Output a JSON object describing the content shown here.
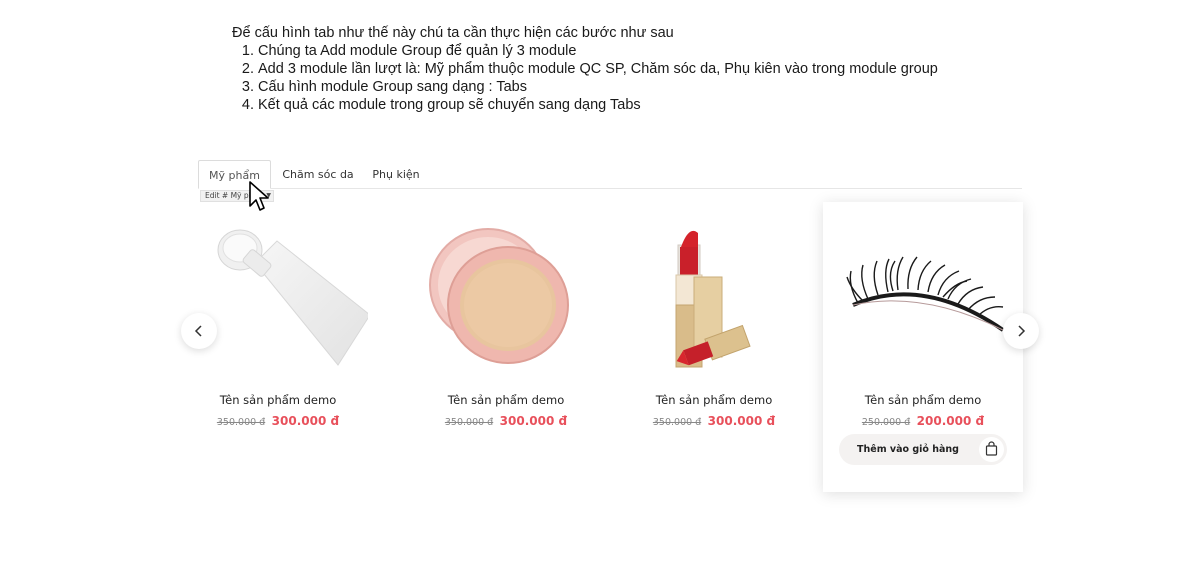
{
  "instructions": {
    "intro": "Để cấu hình tab như thế này chú ta cần thực hiện các bước như sau",
    "steps": [
      "Chúng ta Add module Group để quản lý 3 module",
      "Add 3 module lần lượt là: Mỹ phẩm thuộc module QC SP, Chăm sóc da, Phụ kiên vào trong module group",
      "Cấu hình module Group sang dạng : Tabs",
      "Kết quả các module trong group sẽ chuyển sang dạng Tabs"
    ]
  },
  "tabs": [
    {
      "label": "Mỹ phẩm",
      "active": true
    },
    {
      "label": "Chăm sóc da",
      "active": false
    },
    {
      "label": "Phụ kiện",
      "active": false
    }
  ],
  "edit_badge": "Edit # Mỹ phẩm",
  "products": [
    {
      "name": "Tên sản phẩm demo",
      "old_price": "350.000 đ",
      "price": "300.000 đ",
      "image": "cream-tube"
    },
    {
      "name": "Tên sản phẩm demo",
      "old_price": "350.000 đ",
      "price": "300.000 đ",
      "image": "powder-compact"
    },
    {
      "name": "Tên sản phẩm demo",
      "old_price": "350.000 đ",
      "price": "300.000 đ",
      "image": "lipstick"
    },
    {
      "name": "Tên sản phẩm demo",
      "old_price": "250.000 đ",
      "price": "200.000 đ",
      "image": "eyelashes",
      "cart_label": "Thêm vào giỏ hàng"
    }
  ],
  "icons": {
    "prev": "chevron-left-icon",
    "next": "chevron-right-icon",
    "cart": "shopping-bag-icon"
  },
  "colors": {
    "sale_price": "#e8505b",
    "old_price": "#888888",
    "cart_button_bg": "#f4f2f1"
  }
}
